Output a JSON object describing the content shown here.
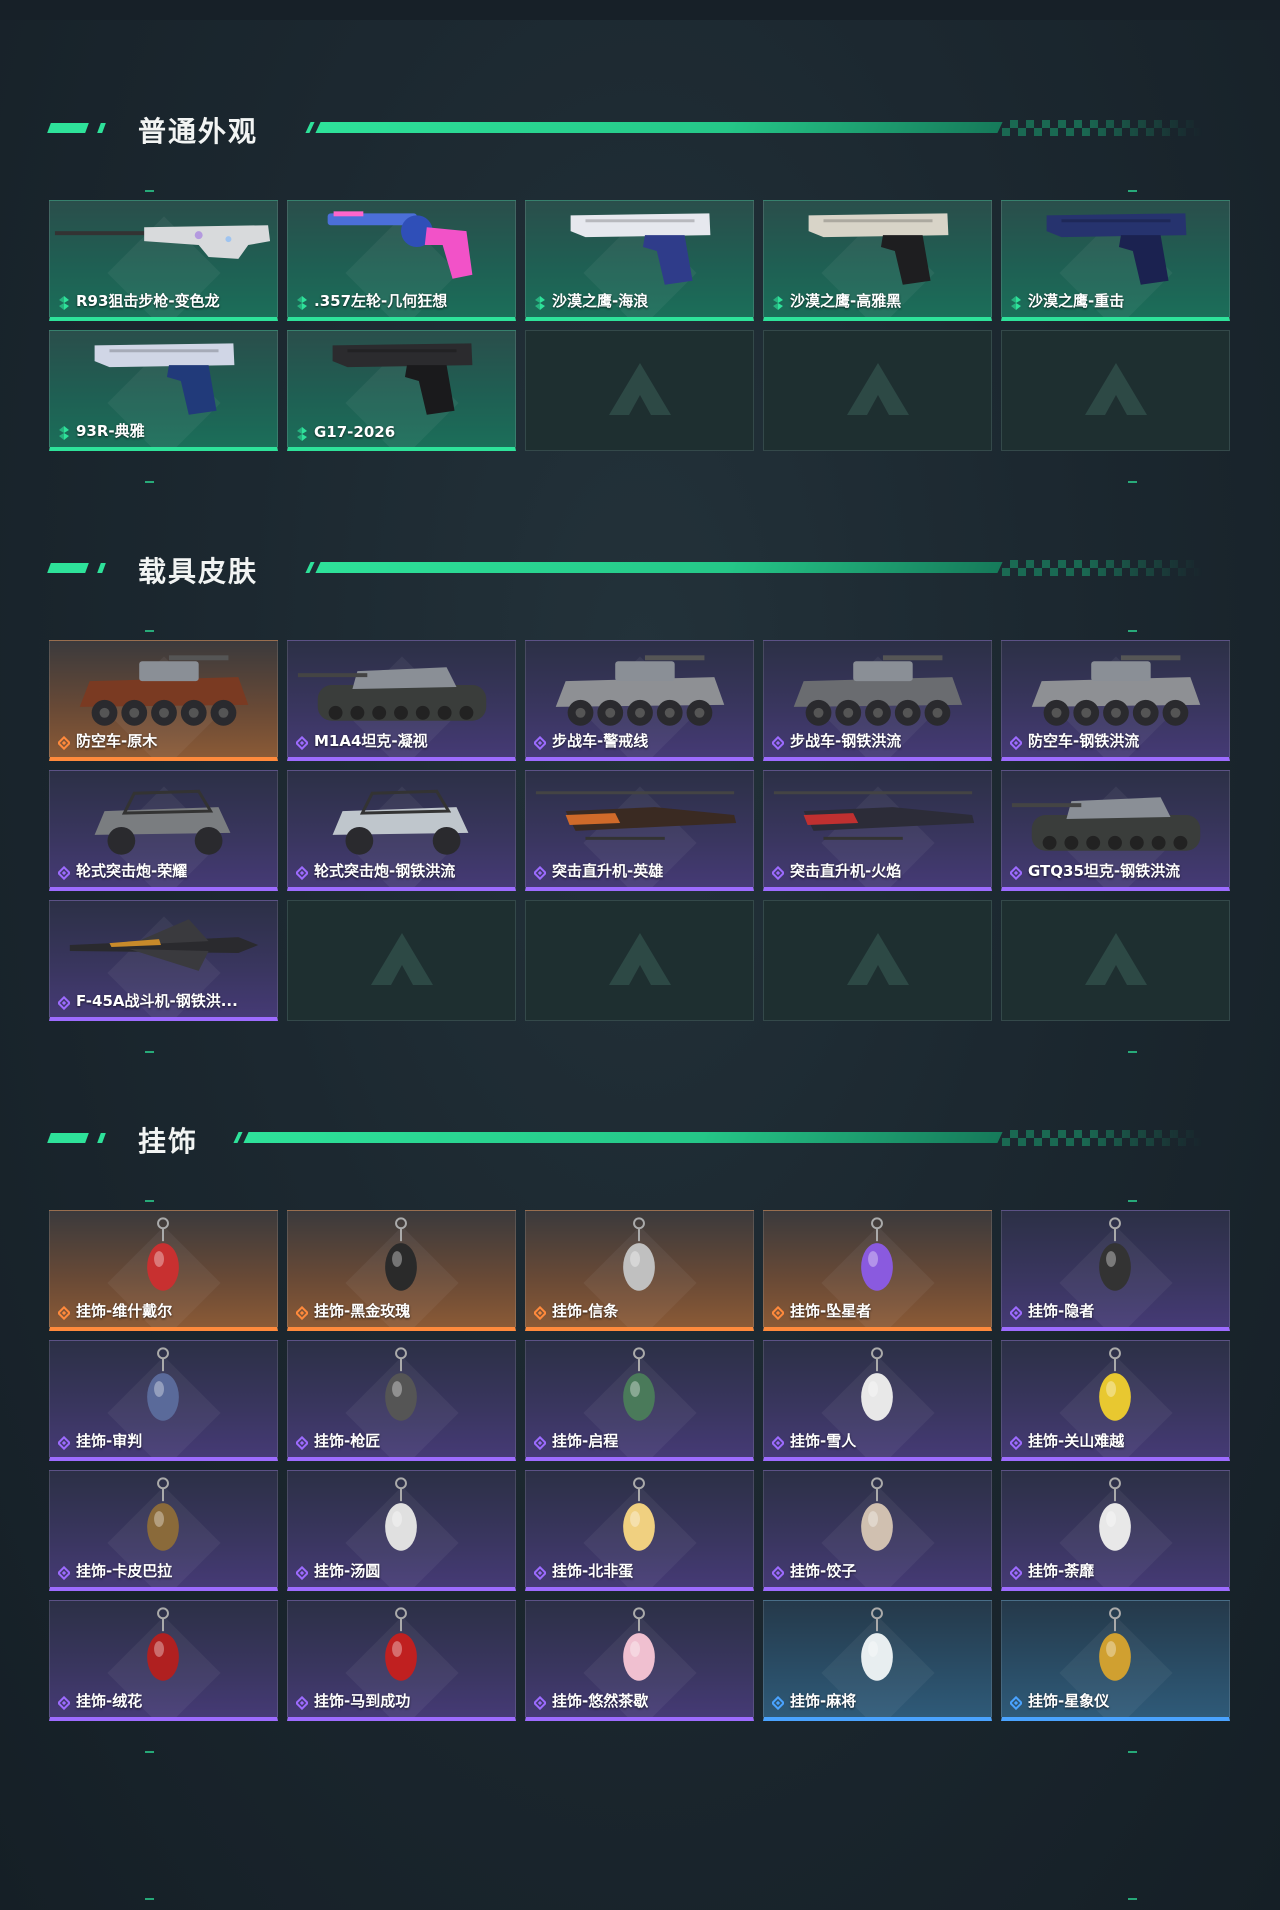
{
  "colors": {
    "accent": "#2ee29a",
    "rarity_green": "#2ee29a",
    "rarity_purple": "#9d6bff",
    "rarity_orange": "#ff8a3c",
    "rarity_blue": "#4aa3ff"
  },
  "sections": [
    {
      "title": "普通外观",
      "items": [
        {
          "name": "R93狙击步枪-变色龙",
          "rarity": "green",
          "icon": "sniper-rifle-icon"
        },
        {
          "name": ".357左轮-几何狂想",
          "rarity": "green",
          "icon": "revolver-icon"
        },
        {
          "name": "沙漠之鹰-海浪",
          "rarity": "green",
          "icon": "pistol-icon"
        },
        {
          "name": "沙漠之鹰-高雅黑",
          "rarity": "green",
          "icon": "pistol-icon"
        },
        {
          "name": "沙漠之鹰-重击",
          "rarity": "green",
          "icon": "pistol-icon"
        },
        {
          "name": "93R-典雅",
          "rarity": "green",
          "icon": "pistol-icon"
        },
        {
          "name": "G17-2026",
          "rarity": "green",
          "icon": "pistol-icon"
        },
        {
          "name": "",
          "rarity": "empty",
          "icon": "placeholder-logo-icon"
        },
        {
          "name": "",
          "rarity": "empty",
          "icon": "placeholder-logo-icon"
        },
        {
          "name": "",
          "rarity": "empty",
          "icon": "placeholder-logo-icon"
        }
      ]
    },
    {
      "title": "载具皮肤",
      "items": [
        {
          "name": "防空车-原木",
          "rarity": "orange",
          "icon": "apc-icon"
        },
        {
          "name": "M1A4坦克-凝视",
          "rarity": "purple",
          "icon": "tank-icon"
        },
        {
          "name": "步战车-警戒线",
          "rarity": "purple",
          "icon": "apc-icon"
        },
        {
          "name": "步战车-钢铁洪流",
          "rarity": "purple",
          "icon": "apc-icon"
        },
        {
          "name": "防空车-钢铁洪流",
          "rarity": "purple",
          "icon": "apc-icon"
        },
        {
          "name": "轮式突击炮-荣耀",
          "rarity": "purple",
          "icon": "buggy-icon"
        },
        {
          "name": "轮式突击炮-钢铁洪流",
          "rarity": "purple",
          "icon": "buggy-icon"
        },
        {
          "name": "突击直升机-英雄",
          "rarity": "purple",
          "icon": "helicopter-icon"
        },
        {
          "name": "突击直升机-火焰",
          "rarity": "purple",
          "icon": "helicopter-icon"
        },
        {
          "name": "GTQ35坦克-钢铁洪流",
          "rarity": "purple",
          "icon": "tank-icon"
        },
        {
          "name": "F-45A战斗机-钢铁洪...",
          "rarity": "purple",
          "icon": "jet-icon"
        },
        {
          "name": "",
          "rarity": "empty",
          "icon": "placeholder-logo-icon"
        },
        {
          "name": "",
          "rarity": "empty",
          "icon": "placeholder-logo-icon"
        },
        {
          "name": "",
          "rarity": "empty",
          "icon": "placeholder-logo-icon"
        },
        {
          "name": "",
          "rarity": "empty",
          "icon": "placeholder-logo-icon"
        }
      ]
    },
    {
      "title": "挂饰",
      "items": [
        {
          "name": "挂饰-维什戴尔",
          "rarity": "orange",
          "icon": "charm-icon"
        },
        {
          "name": "挂饰-黑金玫瑰",
          "rarity": "orange",
          "icon": "charm-icon"
        },
        {
          "name": "挂饰-信条",
          "rarity": "orange",
          "icon": "charm-icon"
        },
        {
          "name": "挂饰-坠星者",
          "rarity": "orange",
          "icon": "charm-icon"
        },
        {
          "name": "挂饰-隐者",
          "rarity": "purple",
          "icon": "charm-icon"
        },
        {
          "name": "挂饰-审判",
          "rarity": "purple",
          "icon": "charm-icon"
        },
        {
          "name": "挂饰-枪匠",
          "rarity": "purple",
          "icon": "charm-icon"
        },
        {
          "name": "挂饰-启程",
          "rarity": "purple",
          "icon": "charm-icon"
        },
        {
          "name": "挂饰-雪人",
          "rarity": "purple",
          "icon": "charm-icon"
        },
        {
          "name": "挂饰-关山难越",
          "rarity": "purple",
          "icon": "charm-icon"
        },
        {
          "name": "挂饰-卡皮巴拉",
          "rarity": "purple",
          "icon": "charm-icon"
        },
        {
          "name": "挂饰-汤圆",
          "rarity": "purple",
          "icon": "charm-icon"
        },
        {
          "name": "挂饰-北非蛋",
          "rarity": "purple",
          "icon": "charm-icon"
        },
        {
          "name": "挂饰-饺子",
          "rarity": "purple",
          "icon": "charm-icon"
        },
        {
          "name": "挂饰-荼靡",
          "rarity": "purple",
          "icon": "charm-icon"
        },
        {
          "name": "挂饰-绒花",
          "rarity": "purple",
          "icon": "charm-icon"
        },
        {
          "name": "挂饰-马到成功",
          "rarity": "purple",
          "icon": "charm-icon"
        },
        {
          "name": "挂饰-悠然茶歇",
          "rarity": "purple",
          "icon": "charm-icon"
        },
        {
          "name": "挂饰-麻将",
          "rarity": "blue",
          "icon": "charm-icon"
        },
        {
          "name": "挂饰-星象仪",
          "rarity": "blue",
          "icon": "charm-icon"
        }
      ]
    }
  ]
}
